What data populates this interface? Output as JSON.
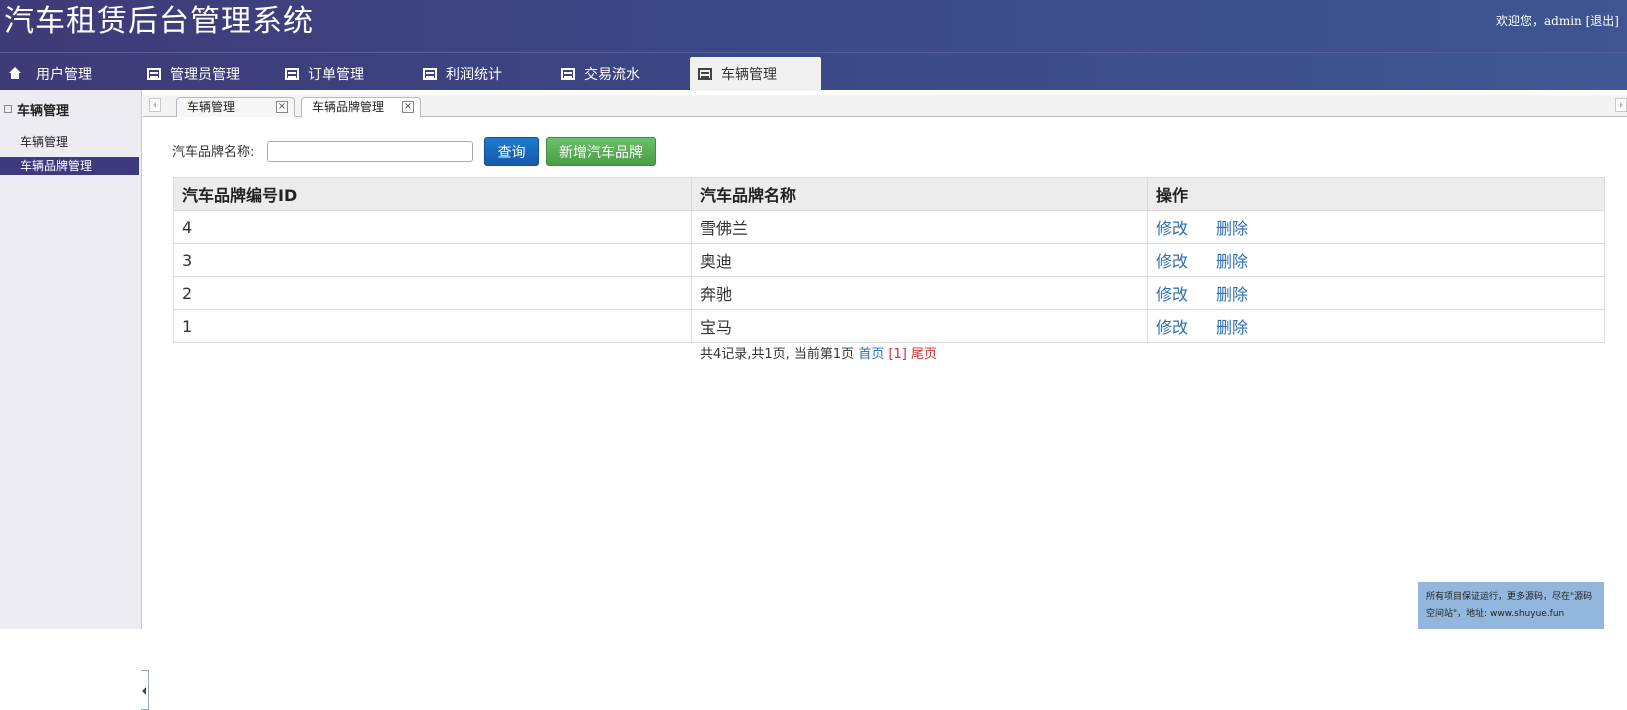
{
  "header": {
    "title": "汽车租赁后台管理系统",
    "welcome": "欢迎您，admin",
    "logout": "[退出]"
  },
  "nav": {
    "tabs": [
      {
        "label": "用户管理",
        "icon": "home-icon"
      },
      {
        "label": "管理员管理",
        "icon": "list-icon"
      },
      {
        "label": "订单管理",
        "icon": "list-icon"
      },
      {
        "label": "利润统计",
        "icon": "list-icon"
      },
      {
        "label": "交易流水",
        "icon": "list-icon"
      },
      {
        "label": "车辆管理",
        "icon": "list-icon",
        "active": true
      }
    ]
  },
  "sidebar": {
    "group": "车辆管理",
    "items": [
      {
        "label": "车辆管理"
      },
      {
        "label": "车辆品牌管理",
        "active": true
      }
    ]
  },
  "page_tabs": [
    {
      "label": "车辆管理"
    },
    {
      "label": "车辆品牌管理",
      "active": true
    }
  ],
  "search": {
    "label": "汽车品牌名称:",
    "value": "",
    "query_button": "查询",
    "add_button": "新增汽车品牌"
  },
  "table": {
    "headers": [
      "汽车品牌编号ID",
      "汽车品牌名称",
      "操作"
    ],
    "rows": [
      {
        "id": "4",
        "name": "雪佛兰"
      },
      {
        "id": "3",
        "name": "奥迪"
      },
      {
        "id": "2",
        "name": "奔驰"
      },
      {
        "id": "1",
        "name": "宝马"
      }
    ],
    "edit_label": "修改",
    "delete_label": "删除"
  },
  "pager": {
    "summary": "共4记录,共1页, 当前第1页",
    "first": "首页",
    "current": "[1]",
    "last": "尾页"
  },
  "ad": {
    "line1": "所有项目保证运行，更多源码，尽在\"源码",
    "line2": "空间站\"，地址: www.shuyue.fun"
  }
}
